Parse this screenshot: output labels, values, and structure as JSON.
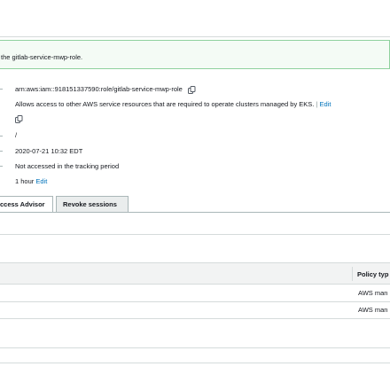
{
  "banner": {
    "text": "the gitlab-service-mwp-role."
  },
  "summary": {
    "arn": "arn:aws:iam::918151337590:role/gitlab-service-mwp-role",
    "description": "Allows access to other AWS service resources that are required to operate clusters managed by EKS.",
    "description_separator": "|",
    "description_edit": "Edit",
    "path": "/",
    "creation_time": "2020-07-21 10:32 EDT",
    "last_activity": "Not accessed in the tracking period",
    "max_session_duration": "1 hour",
    "max_session_edit": "Edit"
  },
  "tabs": [
    {
      "label": "ccess Advisor"
    },
    {
      "label": "Revoke sessions"
    }
  ],
  "policies_table": {
    "column_policy_type": "Policy typ",
    "rows": [
      {
        "policy_type": "AWS man"
      },
      {
        "policy_type": "AWS man"
      }
    ]
  }
}
